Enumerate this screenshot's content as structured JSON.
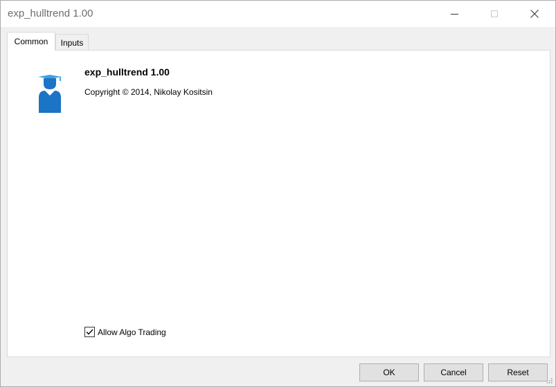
{
  "window": {
    "title": "exp_hulltrend 1.00"
  },
  "tabs": [
    {
      "label": "Common",
      "active": true
    },
    {
      "label": "Inputs",
      "active": false
    }
  ],
  "expert": {
    "name": "exp_hulltrend 1.00",
    "copyright": "Copyright © 2014, Nikolay Kositsin",
    "icon": "graduate-icon"
  },
  "options": {
    "allow_algo_trading": {
      "label": "Allow Algo Trading",
      "checked": true
    }
  },
  "buttons": {
    "ok": "OK",
    "cancel": "Cancel",
    "reset": "Reset"
  },
  "colors": {
    "icon_blue": "#1b74c5",
    "icon_light": "#3ea0e4"
  }
}
